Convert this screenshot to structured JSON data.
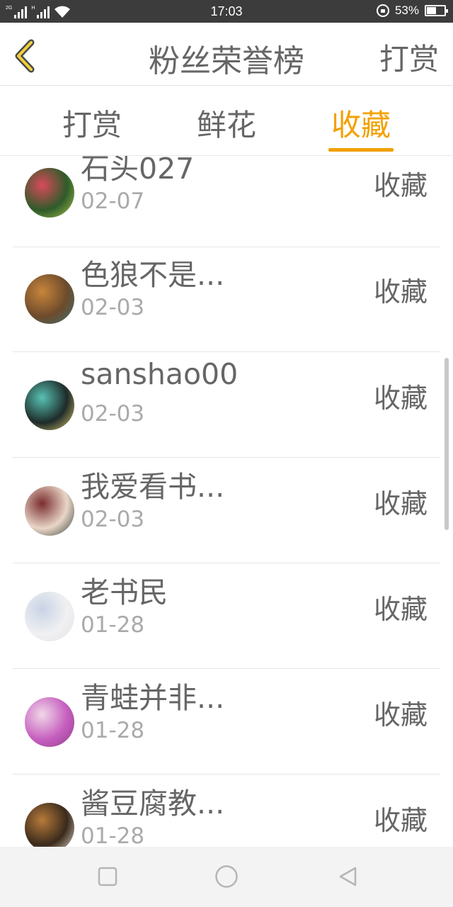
{
  "status_bar": {
    "signal1_tag": "2G",
    "signal2_tag": "H",
    "time": "17:03",
    "battery": "53%",
    "battery_level": 0.53
  },
  "header": {
    "title": "粉丝荣誉榜",
    "action": "打赏"
  },
  "tabs": [
    {
      "label": "打赏",
      "active": false
    },
    {
      "label": "鲜花",
      "active": false
    },
    {
      "label": "收藏",
      "active": true
    }
  ],
  "list": [
    {
      "name": "石头027",
      "date": "02-07",
      "type": "收藏",
      "avatar_colors": [
        "#2f5b2a",
        "#d94a5a",
        "#a7c44b"
      ]
    },
    {
      "name": "色狼不是...",
      "date": "02-03",
      "type": "收藏",
      "avatar_colors": [
        "#6d4b2c",
        "#c8863b",
        "#3b7070"
      ]
    },
    {
      "name": "sanshao00",
      "date": "02-03",
      "type": "收藏",
      "avatar_colors": [
        "#1e2b2a",
        "#58c2b3",
        "#e0c96a"
      ]
    },
    {
      "name": "我爱看书...",
      "date": "02-03",
      "type": "收藏",
      "avatar_colors": [
        "#e9d6c8",
        "#7a2d2d",
        "#2f3a2f"
      ]
    },
    {
      "name": "老书民",
      "date": "01-28",
      "type": "收藏",
      "avatar_colors": [
        "#f0f0f2",
        "#c8d3e6",
        "#e5e5e8"
      ]
    },
    {
      "name": "青蛙并非...",
      "date": "01-28",
      "type": "收藏",
      "avatar_colors": [
        "#c65fbf",
        "#f1d8e8",
        "#8f3d8a"
      ]
    },
    {
      "name": "酱豆腐教...",
      "date": "01-28",
      "type": "收藏",
      "avatar_colors": [
        "#3a2a1c",
        "#b77a3a",
        "#e8e0d0"
      ]
    }
  ]
}
